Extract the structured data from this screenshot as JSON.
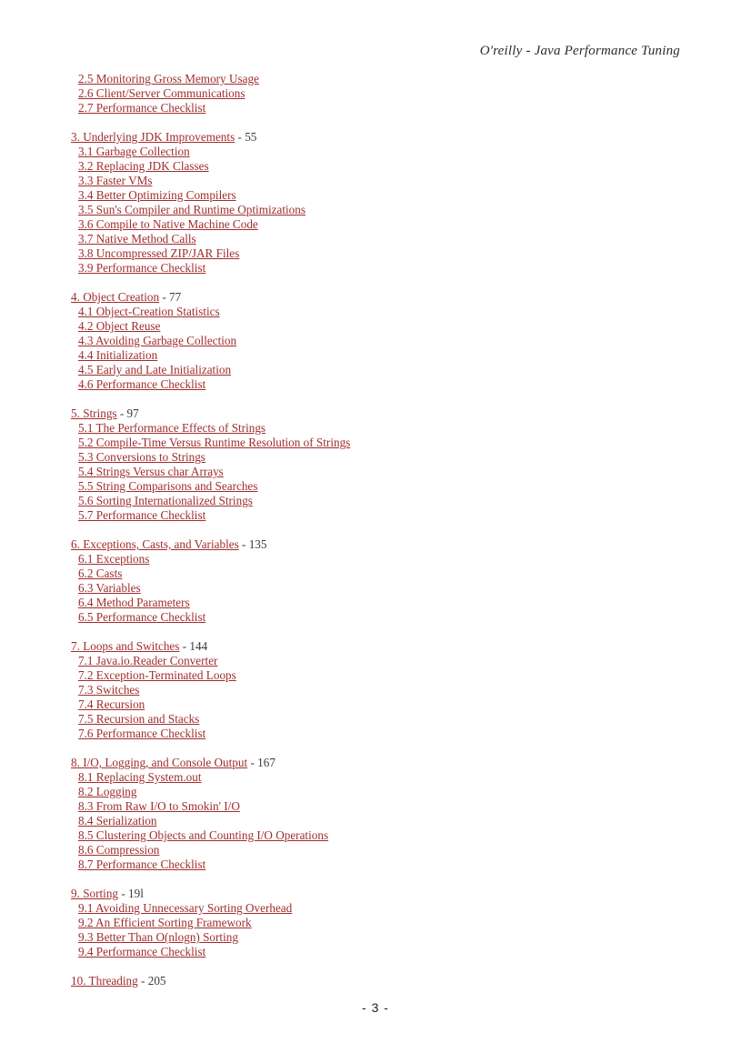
{
  "header": {
    "title": "O'reilly - Java Performance Tuning"
  },
  "footer": {
    "page_marker": "- 3 -"
  },
  "colors": {
    "link": "#a02d2d",
    "page_number": "#3a3a3a",
    "header_text": "#2b2b2b",
    "background": "#ffffff"
  },
  "toc": {
    "groups": [
      {
        "chapter": null,
        "sections": [
          {
            "label": "2.5 Monitoring Gross Memory Usage"
          },
          {
            "label": "2.6 Client/Server Communications"
          },
          {
            "label": "2.7 Performance Checklist"
          }
        ]
      },
      {
        "chapter": {
          "label": "3. Underlying JDK Improvements",
          "page": "- 55"
        },
        "sections": [
          {
            "label": "3.1 Garbage Collection"
          },
          {
            "label": "3.2 Replacing JDK Classes"
          },
          {
            "label": "3.3 Faster VMs"
          },
          {
            "label": "3.4 Better Optimizing Compilers"
          },
          {
            "label": "3.5 Sun's Compiler and Runtime Optimizations"
          },
          {
            "label": "3.6 Compile to Native Machine Code"
          },
          {
            "label": "3.7 Native Method Calls"
          },
          {
            "label": "3.8 Uncompressed ZIP/JAR Files"
          },
          {
            "label": "3.9 Performance Checklist"
          }
        ]
      },
      {
        "chapter": {
          "label": "4. Object Creation",
          "page": "- 77"
        },
        "sections": [
          {
            "label": "4.1 Object-Creation Statistics"
          },
          {
            "label": "4.2 Object Reuse"
          },
          {
            "label": "4.3 Avoiding Garbage Collection"
          },
          {
            "label": "4.4 Initialization"
          },
          {
            "label": "4.5 Early and Late Initialization"
          },
          {
            "label": "4.6 Performance Checklist"
          }
        ]
      },
      {
        "chapter": {
          "label": "5. Strings",
          "page": "- 97"
        },
        "sections": [
          {
            "label": "5.1 The Performance Effects of Strings"
          },
          {
            "label": "5.2 Compile-Time Versus Runtime Resolution of Strings"
          },
          {
            "label": "5.3 Conversions to Strings"
          },
          {
            "label": "5.4 Strings Versus char Arrays"
          },
          {
            "label": "5.5 String Comparisons and Searches"
          },
          {
            "label": "5.6 Sorting Internationalized Strings"
          },
          {
            "label": "5.7 Performance Checklist"
          }
        ]
      },
      {
        "chapter": {
          "label": "6. Exceptions, Casts, and Variables",
          "page": "- 135"
        },
        "sections": [
          {
            "label": "6.1 Exceptions"
          },
          {
            "label": "6.2 Casts"
          },
          {
            "label": "6.3 Variables"
          },
          {
            "label": "6.4 Method Parameters"
          },
          {
            "label": "6.5 Performance Checklist"
          }
        ]
      },
      {
        "chapter": {
          "label": "7. Loops and Switches",
          "page": "- 144"
        },
        "sections": [
          {
            "label": "7.1 Java.io.Reader Converter"
          },
          {
            "label": "7.2 Exception-Terminated Loops"
          },
          {
            "label": "7.3 Switches"
          },
          {
            "label": "7.4 Recursion"
          },
          {
            "label": "7.5 Recursion and Stacks"
          },
          {
            "label": "7.6 Performance Checklist"
          }
        ]
      },
      {
        "chapter": {
          "label": "8. I/O, Logging, and Console Output",
          "page": "- 167"
        },
        "sections": [
          {
            "label": "8.1 Replacing System.out"
          },
          {
            "label": "8.2 Logging"
          },
          {
            "label": "8.3 From Raw I/O to Smokin' I/O"
          },
          {
            "label": "8.4 Serialization"
          },
          {
            "label": "8.5 Clustering Objects and Counting I/O Operations"
          },
          {
            "label": "8.6 Compression"
          },
          {
            "label": "8.7 Performance Checklist"
          }
        ]
      },
      {
        "chapter": {
          "label": "9. Sorting",
          "page": "- 19l"
        },
        "sections": [
          {
            "label": "9.1 Avoiding Unnecessary Sorting Overhead"
          },
          {
            "label": "9.2 An Efficient Sorting Framework"
          },
          {
            "label": "9.3 Better Than O(nlogn) Sorting"
          },
          {
            "label": "9.4 Performance Checklist"
          }
        ]
      },
      {
        "chapter": {
          "label": "10. Threading",
          "page": "- 205"
        },
        "sections": []
      }
    ]
  }
}
